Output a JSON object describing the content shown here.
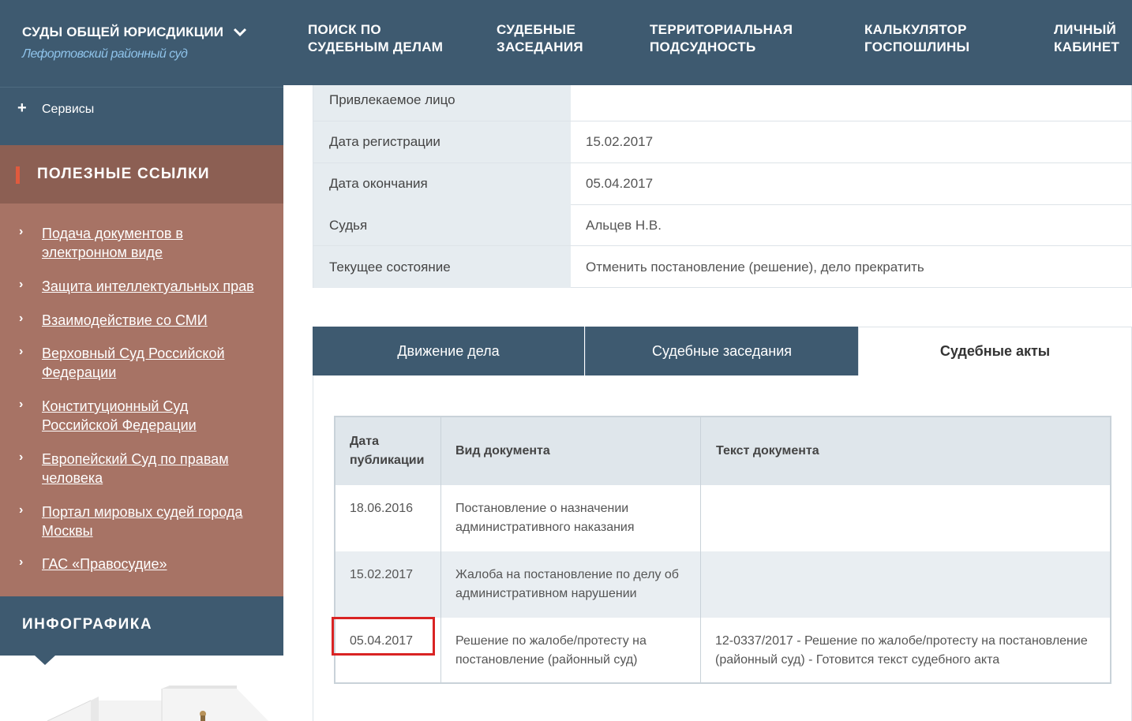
{
  "sidebar": {
    "court_title": "СУДЫ ОБЩЕЙ ЮРИСДИКЦИИ",
    "court_name": "Лефортовский районный суд",
    "services_label": "Сервисы",
    "links_title": "ПОЛЕЗНЫЕ ССЫЛКИ",
    "links": [
      {
        "label": "Подача документов в электронном виде"
      },
      {
        "label": "Защита интеллектуальных прав"
      },
      {
        "label": "Взаимодействие со СМИ"
      },
      {
        "label": "Верховный Суд Российской Федерации"
      },
      {
        "label": "Конституционный Суд Российской Федерации"
      },
      {
        "label": "Европейский Суд по правам человека"
      },
      {
        "label": "Портал мировых судей города Москвы"
      },
      {
        "label": "ГАС «Правосудие»"
      }
    ],
    "infographic_title": "ИНФОГРАФИКА"
  },
  "nav": {
    "items": [
      {
        "label": "ПОИСК ПО СУДЕБНЫМ ДЕЛАМ"
      },
      {
        "label": "СУДЕБНЫЕ ЗАСЕДАНИЯ"
      },
      {
        "label": "ТЕРРИТОРИАЛЬНАЯ ПОДСУДНОСТЬ"
      },
      {
        "label": "КАЛЬКУЛЯТОР ГОСПОШЛИНЫ"
      },
      {
        "label": "ЛИЧНЫЙ КАБИНЕТ"
      }
    ]
  },
  "case_info": {
    "rows": [
      {
        "label": "Привлекаемое лицо",
        "value": ""
      },
      {
        "label": "Дата регистрации",
        "value": "15.02.2017"
      },
      {
        "label": "Дата окончания",
        "value": "05.04.2017"
      },
      {
        "label": "Судья",
        "value": "Альцев Н.В."
      },
      {
        "label": "Текущее состояние",
        "value": "Отменить постановление (решение), дело прекратить"
      }
    ]
  },
  "tabs": {
    "items": [
      {
        "label": "Движение дела"
      },
      {
        "label": "Судебные заседания"
      },
      {
        "label": "Судебные акты"
      }
    ],
    "active": "Судебные акты"
  },
  "acts_table": {
    "headers": {
      "date": "Дата публикации",
      "type": "Вид документа",
      "text": "Текст документа"
    },
    "rows": [
      {
        "date": "18.06.2016",
        "type": "Постановление о назначении административного наказания",
        "text": ""
      },
      {
        "date": "15.02.2017",
        "type": "Жалоба на постановление по делу об административном нарушении",
        "text": ""
      },
      {
        "date": "05.04.2017",
        "type": "Решение по жалобе/протесту на постановление (районный суд)",
        "text": "12-0337/2017 - Решение по жалобе/протесту на постановление (районный суд) - Готовится текст судебного акта"
      }
    ]
  },
  "colors": {
    "dark_blue": "#3e5a70",
    "links_bg": "#a77365",
    "links_head_bg": "#8c5f53",
    "accent_red": "#e05a3e",
    "highlight": "#d92323"
  }
}
